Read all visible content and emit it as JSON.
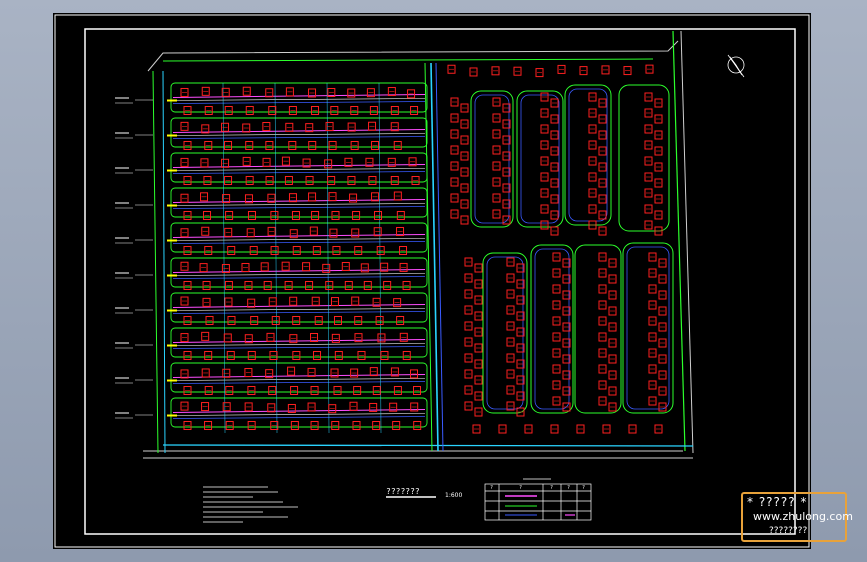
{
  "drawing": {
    "background_color": "#000000",
    "frame_color": "#ffffff",
    "road_color": "#cfcfcf",
    "road_line_colors": [
      "#2cff2c",
      "#2ad4ff",
      "#3a5bff",
      "#ff4dff"
    ],
    "building_color": "#ff2020",
    "text_color": "#ffffff",
    "scale_title": "???????",
    "scale_label": "1:600",
    "legend_header": [
      "?",
      "?",
      "?",
      "?",
      "?"
    ]
  },
  "watermark": {
    "line1": "* ????? *",
    "line2": "www.zhulong.com",
    "line3": "????????",
    "border_color": "#e8a23a"
  },
  "icons": [
    "north-arrow-icon"
  ]
}
